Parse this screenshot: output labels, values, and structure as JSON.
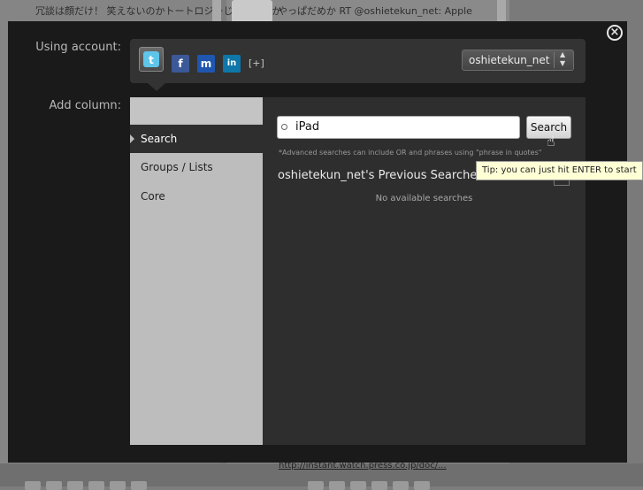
{
  "background": {
    "tweet_left": "冗談は顔だけ！ 笑えないのかトートロジーじゃないのか",
    "tweet_right": "やっぱだめか RT @oshietekun_net: Apple",
    "link_bottom": "http://instant.watch.press.co.jp/doc/..."
  },
  "modal": {
    "close_label": "×",
    "using_account_label": "Using account:",
    "add_column_label": "Add column:",
    "networks": [
      {
        "name": "twitter",
        "glyph": "t",
        "color": "#5fc5ea"
      },
      {
        "name": "facebook",
        "glyph": "f",
        "color": "#3b5998"
      },
      {
        "name": "myspace",
        "glyph": "m",
        "color": "#1f56b0"
      },
      {
        "name": "linkedin",
        "glyph": "in",
        "color": "#0e76a8"
      }
    ],
    "add_network_label": "[+]",
    "account_selected": "oshietekun_net",
    "column_types": [
      "Search",
      "Groups / Lists",
      "Core"
    ],
    "search": {
      "value": "iPad",
      "button_label": "Search",
      "hint": "*Advanced searches can include OR and phrases using \"phrase in quotes\"",
      "previous_title": "oshietekun_net's Previous Searches:",
      "no_searches": "No available searches"
    },
    "tooltip": "Tip: you can just hit ENTER to start"
  }
}
